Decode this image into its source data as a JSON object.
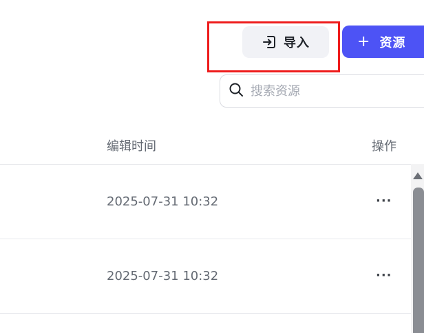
{
  "toolbar": {
    "import_label": "导入",
    "add_label": "资源",
    "add_icon": "+",
    "accent_color": "#4d53f5",
    "highlight_color": "#ee1c1c"
  },
  "search": {
    "placeholder": "搜索资源"
  },
  "table": {
    "headers": {
      "edit_time": "编辑时间",
      "operations": "操作"
    },
    "rows": [
      {
        "edit_time": "2025-07-31 10:32",
        "more": "···"
      },
      {
        "edit_time": "2025-07-31 10:32",
        "more": "···"
      }
    ]
  }
}
